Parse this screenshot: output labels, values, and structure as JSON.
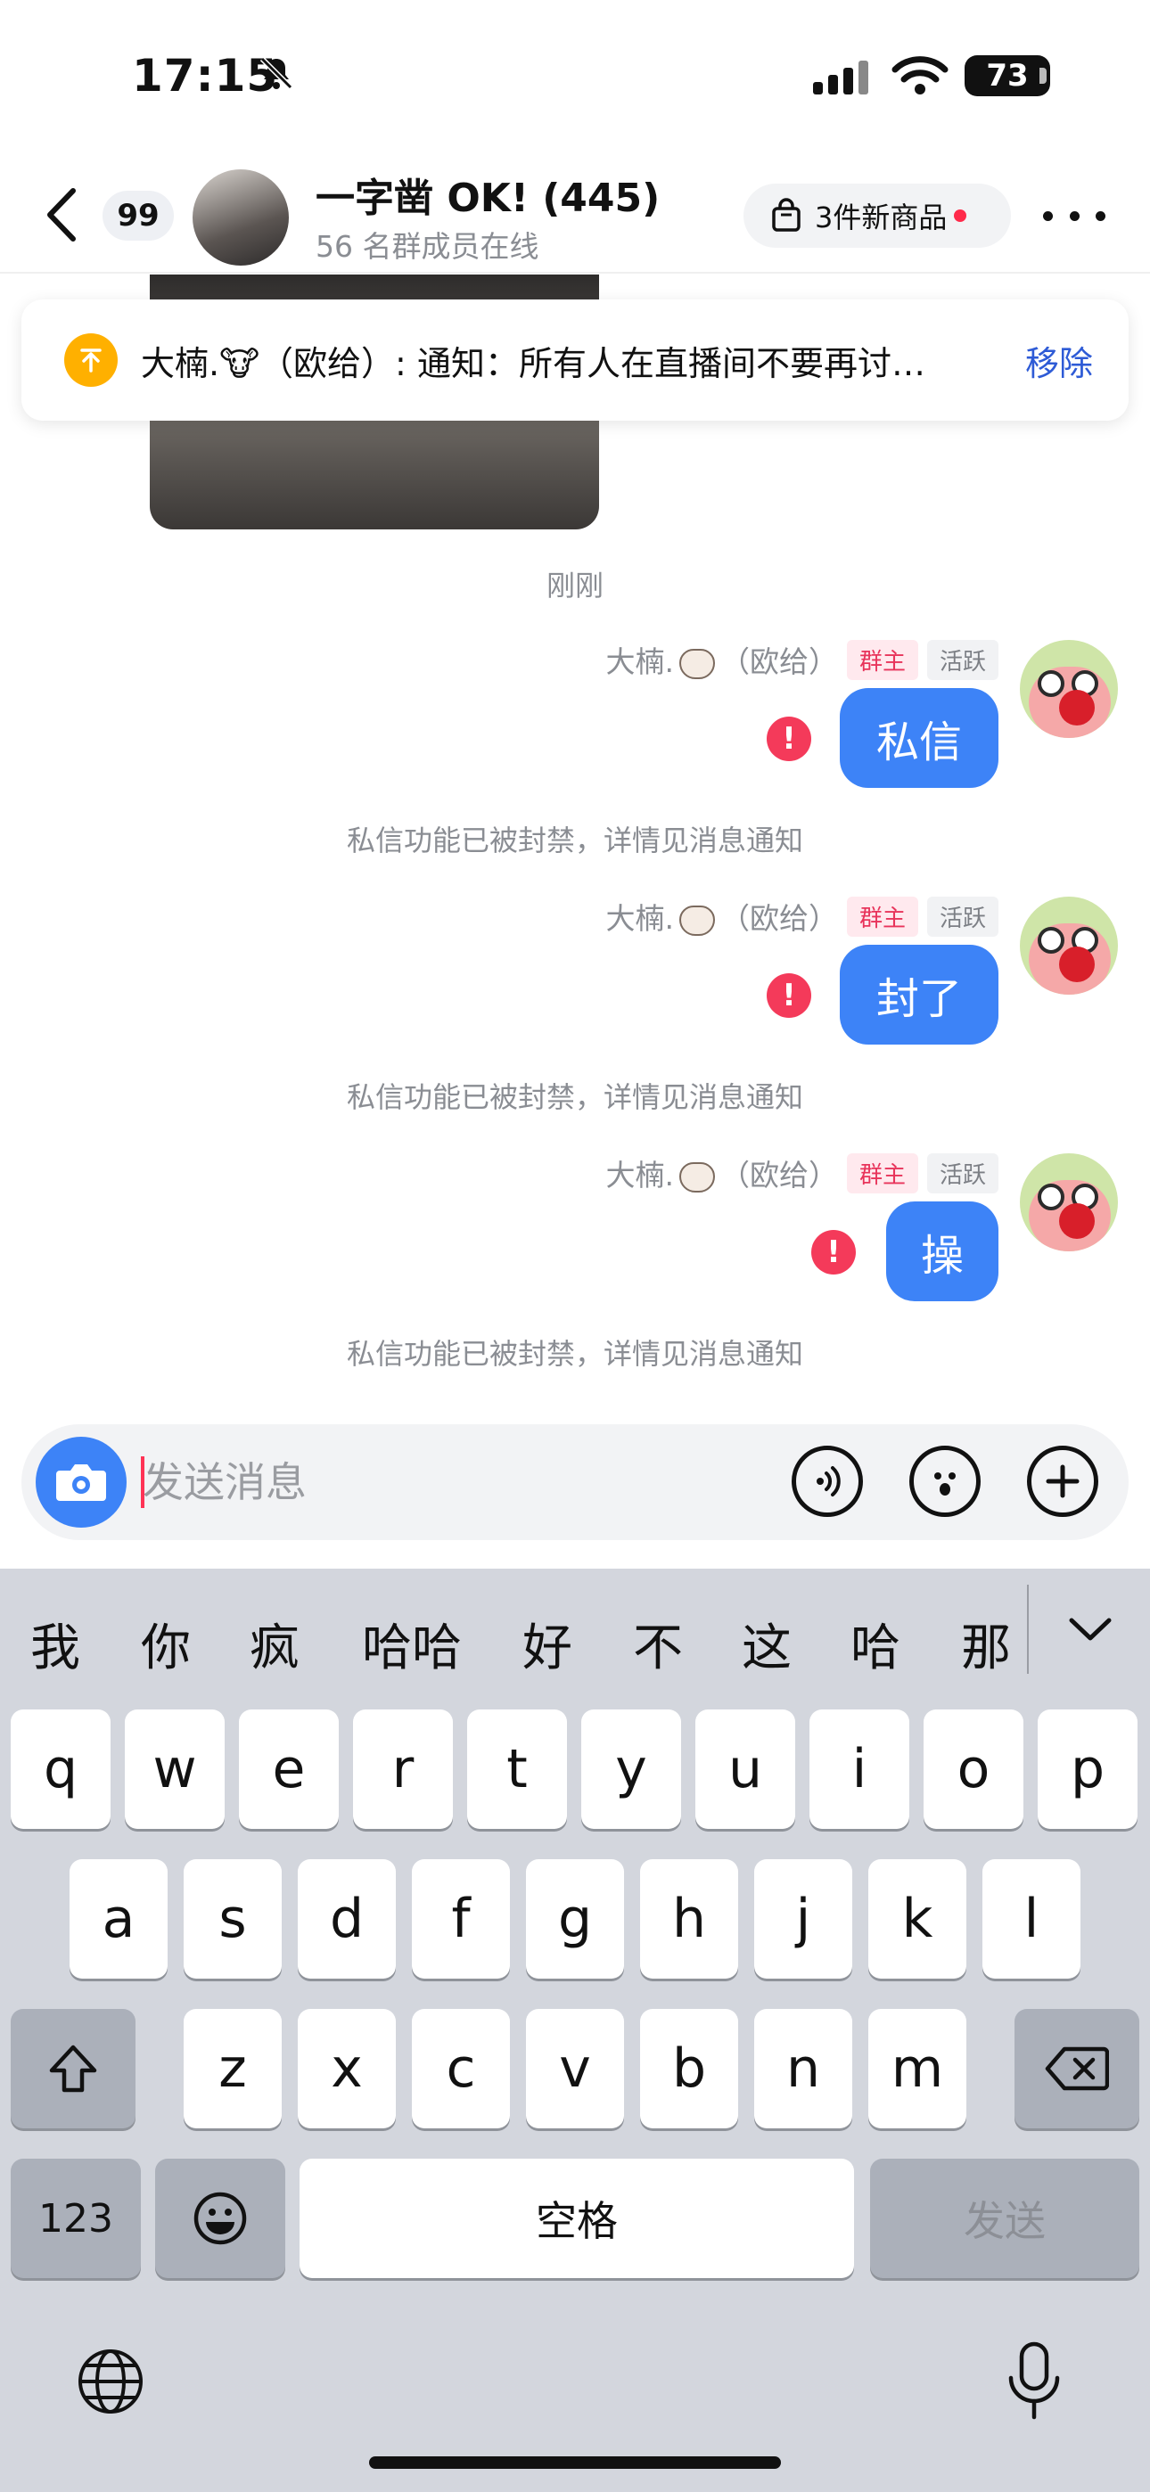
{
  "status_bar": {
    "time": "17:15",
    "battery": "73"
  },
  "header": {
    "unread_count": "99",
    "title": "一字凿 OK! (445)",
    "subtitle": "56 名群成员在线",
    "goods_label": "3件新商品"
  },
  "pinned_notice": {
    "text": "大楠.🐮（欧给）: 通知：所有人在直播间不要再讨…",
    "remove_label": "移除"
  },
  "timestamp": "刚刚",
  "messages": [
    {
      "sender": "大楠.",
      "sender_suffix": "（欧给）",
      "badge_owner": "群主",
      "badge_active": "活跃",
      "text": "私信",
      "system_note": "私信功能已被封禁，详情见消息通知"
    },
    {
      "sender": "大楠.",
      "sender_suffix": "（欧给）",
      "badge_owner": "群主",
      "badge_active": "活跃",
      "text": "封了",
      "system_note": "私信功能已被封禁，详情见消息通知"
    },
    {
      "sender": "大楠.",
      "sender_suffix": "（欧给）",
      "badge_owner": "群主",
      "badge_active": "活跃",
      "text": "操",
      "system_note": "私信功能已被封禁，详情见消息通知"
    }
  ],
  "input": {
    "placeholder": "发送消息"
  },
  "keyboard": {
    "candidates": [
      "我",
      "你",
      "疯",
      "哈哈",
      "好",
      "不",
      "这",
      "哈",
      "那"
    ],
    "row1": [
      "q",
      "w",
      "e",
      "r",
      "t",
      "y",
      "u",
      "i",
      "o",
      "p"
    ],
    "row2": [
      "a",
      "s",
      "d",
      "f",
      "g",
      "h",
      "j",
      "k",
      "l"
    ],
    "row3": [
      "z",
      "x",
      "c",
      "v",
      "b",
      "n",
      "m"
    ],
    "numbers_key": "123",
    "space_key": "空格",
    "send_key": "发送"
  },
  "colors": {
    "accent": "#3d83f7",
    "error": "#f43a5a",
    "pin": "#ffb000"
  }
}
